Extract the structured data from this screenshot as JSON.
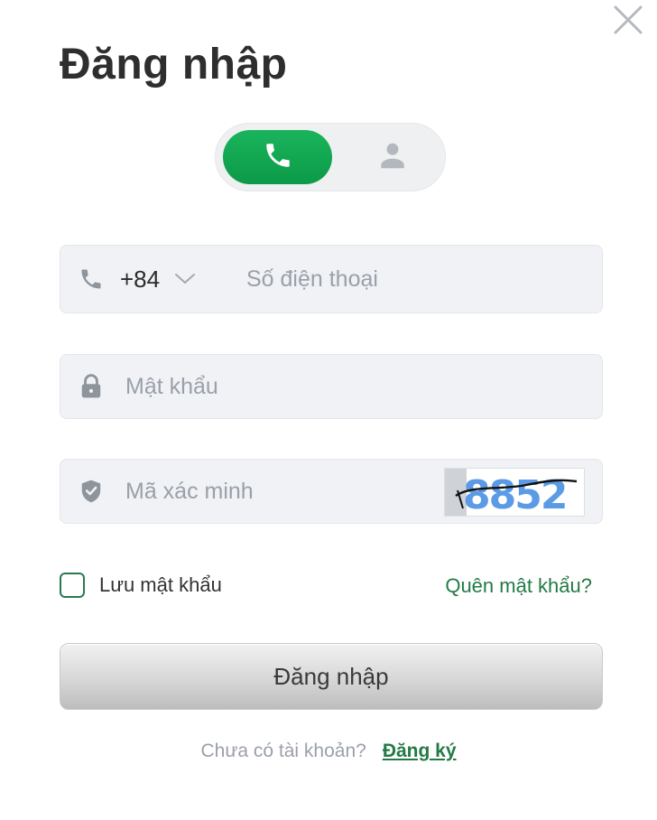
{
  "dialog": {
    "title": "Đăng nhập",
    "close_icon": "close-icon"
  },
  "login_mode": {
    "options": [
      {
        "id": "phone",
        "icon": "phone-icon",
        "active": true
      },
      {
        "id": "account",
        "icon": "user-icon",
        "active": false
      }
    ],
    "active_color": "#12a852"
  },
  "form": {
    "phone": {
      "icon": "phone-icon",
      "country_code": "+84",
      "country_chevron": "chevron-down-icon",
      "value": "",
      "placeholder": "Số điện thoại"
    },
    "password": {
      "icon": "lock-icon",
      "value": "",
      "placeholder": "Mật khẩu"
    },
    "verification": {
      "icon": "shield-icon",
      "value": "",
      "placeholder": "Mã xác minh",
      "captcha_text": "8852"
    },
    "remember": {
      "label": "Lưu mật khẩu",
      "checked": false
    },
    "forgot_label": "Quên mật khẩu?",
    "submit_label": "Đăng nhập"
  },
  "footer": {
    "question": "Chưa có tài khoản?",
    "signup_label": "Đăng ký"
  },
  "colors": {
    "accent_green": "#12a852",
    "link_green": "#237a45",
    "field_bg": "#f0f2f5",
    "placeholder": "#9aa0aa"
  }
}
